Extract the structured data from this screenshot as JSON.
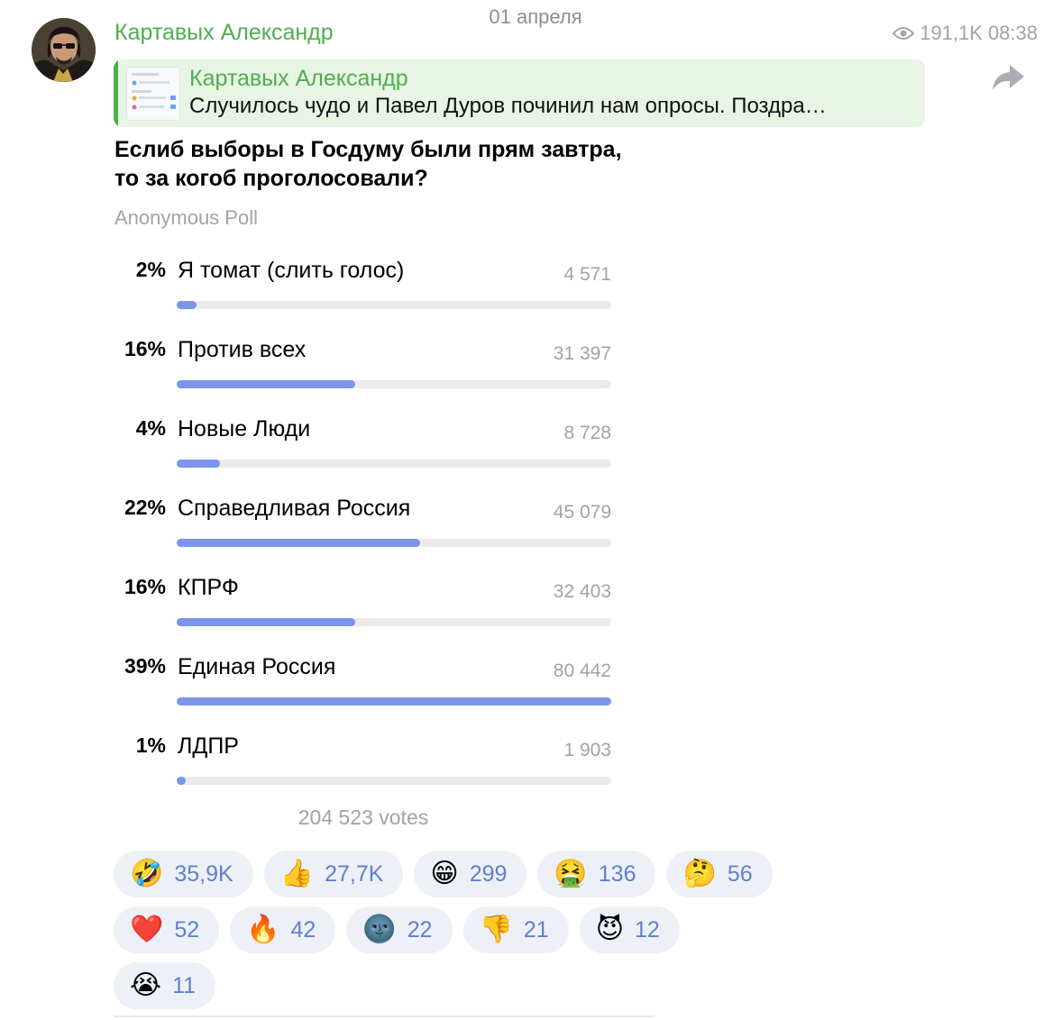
{
  "date_header": "01 апреля",
  "message": {
    "author": "Картавых Александр",
    "views": "191,1K",
    "time": "08:38",
    "reply": {
      "author": "Картавых Александр",
      "text": "Случилось чудо и Павел Дуров починил нам опросы. Поздра…"
    },
    "question_line1": "Еслиб выборы в Госдуму были прям завтра,",
    "question_line2": "то за когоб проголосовали?",
    "poll_type": "Anonymous Poll",
    "options": [
      {
        "percent": "2%",
        "label": "Я томат (слить голос)",
        "votes": "4 571",
        "fill": 0.045
      },
      {
        "percent": "16%",
        "label": "Против всех",
        "votes": "31 397",
        "fill": 0.41
      },
      {
        "percent": "4%",
        "label": "Новые Люди",
        "votes": "8 728",
        "fill": 0.1
      },
      {
        "percent": "22%",
        "label": "Справедливая Россия",
        "votes": "45 079",
        "fill": 0.56
      },
      {
        "percent": "16%",
        "label": "КПРФ",
        "votes": "32 403",
        "fill": 0.41
      },
      {
        "percent": "39%",
        "label": "Единая Россия",
        "votes": "80 442",
        "fill": 1.0
      },
      {
        "percent": "1%",
        "label": "ЛДПР",
        "votes": "1 903",
        "fill": 0.02
      }
    ],
    "total_votes": "204 523 votes"
  },
  "reactions": [
    {
      "emoji": "🤣",
      "count": "35,9K"
    },
    {
      "emoji": "👍",
      "count": "27,7K"
    },
    {
      "emoji": "😁",
      "count": "299"
    },
    {
      "emoji": "🤮",
      "count": "136"
    },
    {
      "emoji": "🤔",
      "count": "56"
    },
    {
      "emoji": "❤️",
      "count": "52"
    },
    {
      "emoji": "🔥",
      "count": "42"
    },
    {
      "emoji": "🌚",
      "count": "22"
    },
    {
      "emoji": "👎",
      "count": "21"
    },
    {
      "emoji": "😈",
      "count": "12"
    },
    {
      "emoji": "😭",
      "count": "11"
    }
  ],
  "icons": {
    "views": "eye-icon",
    "share": "share-arrow-icon",
    "avatar": "avatar-image"
  },
  "colors": {
    "accent_green": "#4fae4e",
    "reply_bg": "#e8f5e4",
    "poll_fill": "#7a95ea",
    "reaction_bg": "#edf1f7",
    "reaction_count": "#5f7fd0",
    "muted": "#a2a2a7"
  }
}
